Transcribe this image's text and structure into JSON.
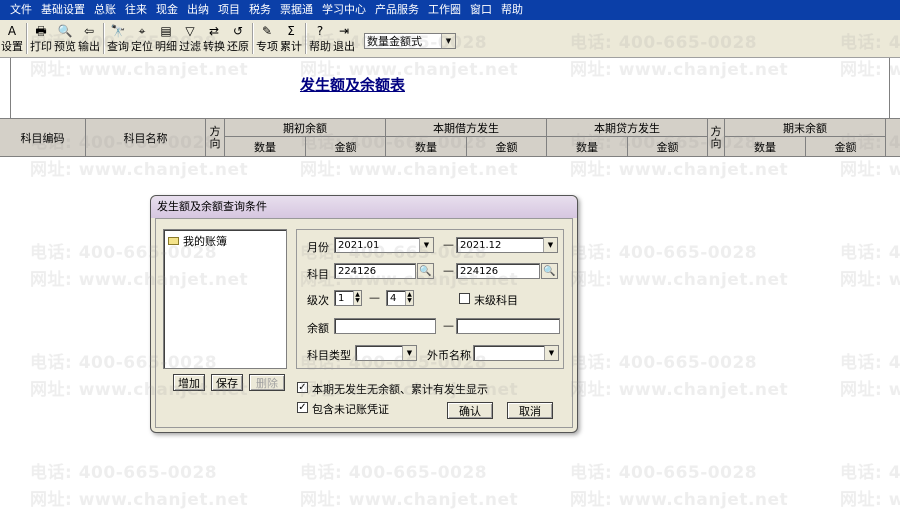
{
  "menu": [
    "文件",
    "基础设置",
    "总账",
    "往来",
    "现金",
    "出纳",
    "项目",
    "税务",
    "票据通",
    "学习中心",
    "产品服务",
    "工作圈",
    "窗口",
    "帮助"
  ],
  "toolbar": {
    "buttons": [
      {
        "label": "设置",
        "icon": "A"
      },
      {
        "label": "打印",
        "icon": "🖶"
      },
      {
        "label": "预览",
        "icon": "🔍"
      },
      {
        "label": "输出",
        "icon": "⇦"
      },
      {
        "label": "查询",
        "icon": "🔭"
      },
      {
        "label": "定位",
        "icon": "⌖"
      },
      {
        "label": "明细",
        "icon": "▤"
      },
      {
        "label": "过滤",
        "icon": "▽"
      },
      {
        "label": "转换",
        "icon": "⇄"
      },
      {
        "label": "还原",
        "icon": "↺"
      },
      {
        "label": "专项",
        "icon": "✎"
      },
      {
        "label": "累计",
        "icon": "Σ"
      },
      {
        "label": "帮助",
        "icon": "?"
      },
      {
        "label": "退出",
        "icon": "⇥"
      }
    ],
    "format_select": "数量金额式"
  },
  "report": {
    "title": "发生额及余额表",
    "columns": {
      "code": "科目编码",
      "name": "科目名称",
      "direction": "方向",
      "opening": "期初余额",
      "debit": "本期借方发生",
      "credit": "本期贷方发生",
      "closing": "期末余额",
      "qty": "数量",
      "amount": "金额"
    }
  },
  "watermark": {
    "phone": "电话: 400-665-0028",
    "site": "网址: www.chanjet.net"
  },
  "dialog": {
    "title": "发生额及余额查询条件",
    "tree_root": "我的账簿",
    "buttons": {
      "add": "增加",
      "save": "保存",
      "delete": "删除",
      "ok": "确认",
      "cancel": "取消"
    },
    "period_label": "月份",
    "period_from": "2021.01",
    "period_to": "2021.12",
    "account_label": "科目",
    "account_from": "224126",
    "account_to": "224126",
    "level_label": "级次",
    "level_from": "1",
    "level_to": "4",
    "leaf_label": "末级科目",
    "leaf_checked": false,
    "balance_label": "余额",
    "balance_from": "",
    "balance_to": "",
    "account_type_label": "科目类型",
    "account_type": "",
    "currency_label": "外币名称",
    "currency": "",
    "dash": "—",
    "option1": "本期无发生无余额、累计有发生显示",
    "option1_checked": true,
    "option2": "包含未记账凭证",
    "option2_checked": true
  }
}
